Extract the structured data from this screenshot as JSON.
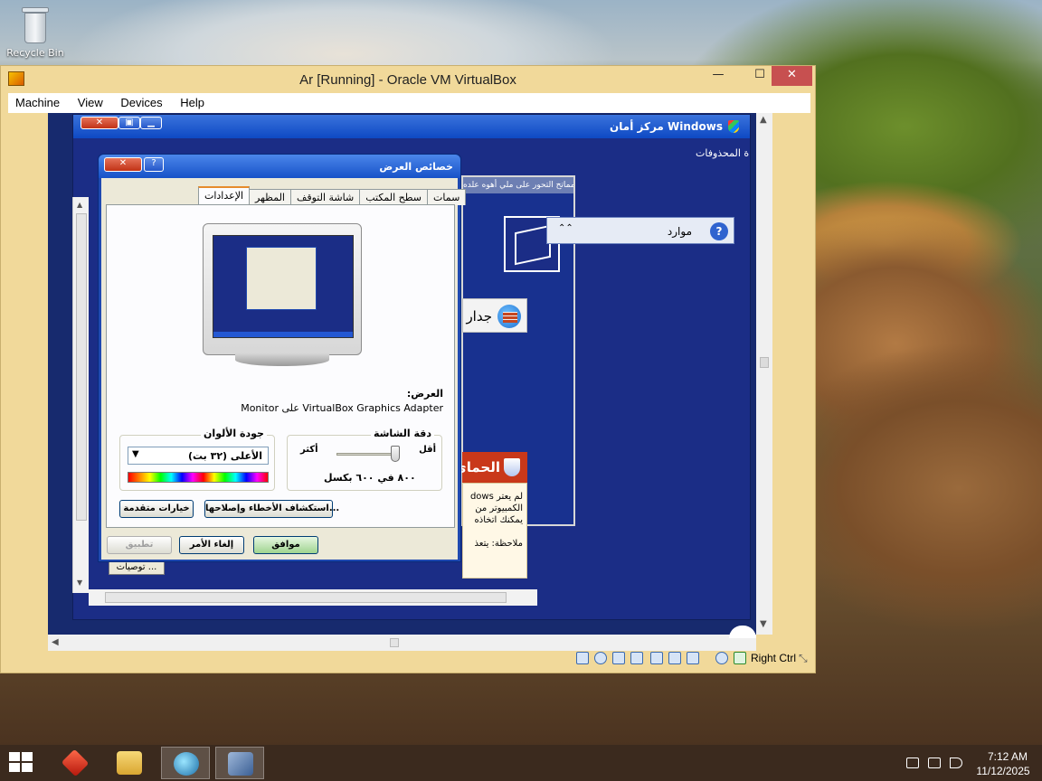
{
  "desktop": {
    "recycle_bin_label": "Recycle Bin"
  },
  "vbox": {
    "title": "Ar [Running] - Oracle VM VirtualBox",
    "menu": [
      "Machine",
      "View",
      "Devices",
      "Help"
    ],
    "window_controls": {
      "minimize": "—",
      "maximize": "☐",
      "close": "✕"
    },
    "host_key": "Right Ctrl"
  },
  "security_center": {
    "title": "مركز أمان Windows",
    "sub_label": "ة المحذوفات",
    "panel_header": "مماتح التحور على ملي أهوه علده",
    "resources_label": "موارد",
    "help_glyph": "?",
    "firewall_label": "جدار",
    "protect_label": "الحماي",
    "protect_lines": [
      "لم يعتر dows",
      "الكمبيوتر من",
      "يمكنك اتخاذه",
      "",
      "ملاحظة: يتعذ"
    ],
    "recommendations_button": "توصيات ..."
  },
  "display_properties": {
    "title": "خصائص العرض",
    "help_glyph": "?",
    "close_glyph": "✕",
    "tabs": [
      "سمات",
      "سطح المكتب",
      "شاشة التوقف",
      "المظهر",
      "الإعدادات"
    ],
    "active_tab": "الإعدادات",
    "display_label": "العرض:",
    "display_value": "Monitor على VirtualBox Graphics Adapter",
    "resolution": {
      "group_label": "دقة الشاشة",
      "less_label": "أقل",
      "more_label": "أكثر",
      "value_text": "٨٠٠ في ٦٠٠ بكسل"
    },
    "color_quality": {
      "group_label": "جودة الألوان",
      "selected": "الأعلى (٣٢ بت)"
    },
    "buttons": {
      "troubleshoot": "استكشاف الأخطاء وإصلاحها...",
      "advanced": "خيارات متقدمة",
      "ok": "موافق",
      "cancel": "إلغاء الأمر",
      "apply": "تطبيق"
    }
  },
  "taskbar": {
    "time": "7:12 AM",
    "date": "11/12/2025"
  },
  "icons": [
    "windows-start-icon",
    "app-red-icon",
    "file-explorer-icon",
    "network-globe-icon",
    "virtualbox-icon",
    "recycle-bin-icon",
    "shield-icon",
    "help-icon",
    "firewall-icon",
    "monitor-icon"
  ]
}
